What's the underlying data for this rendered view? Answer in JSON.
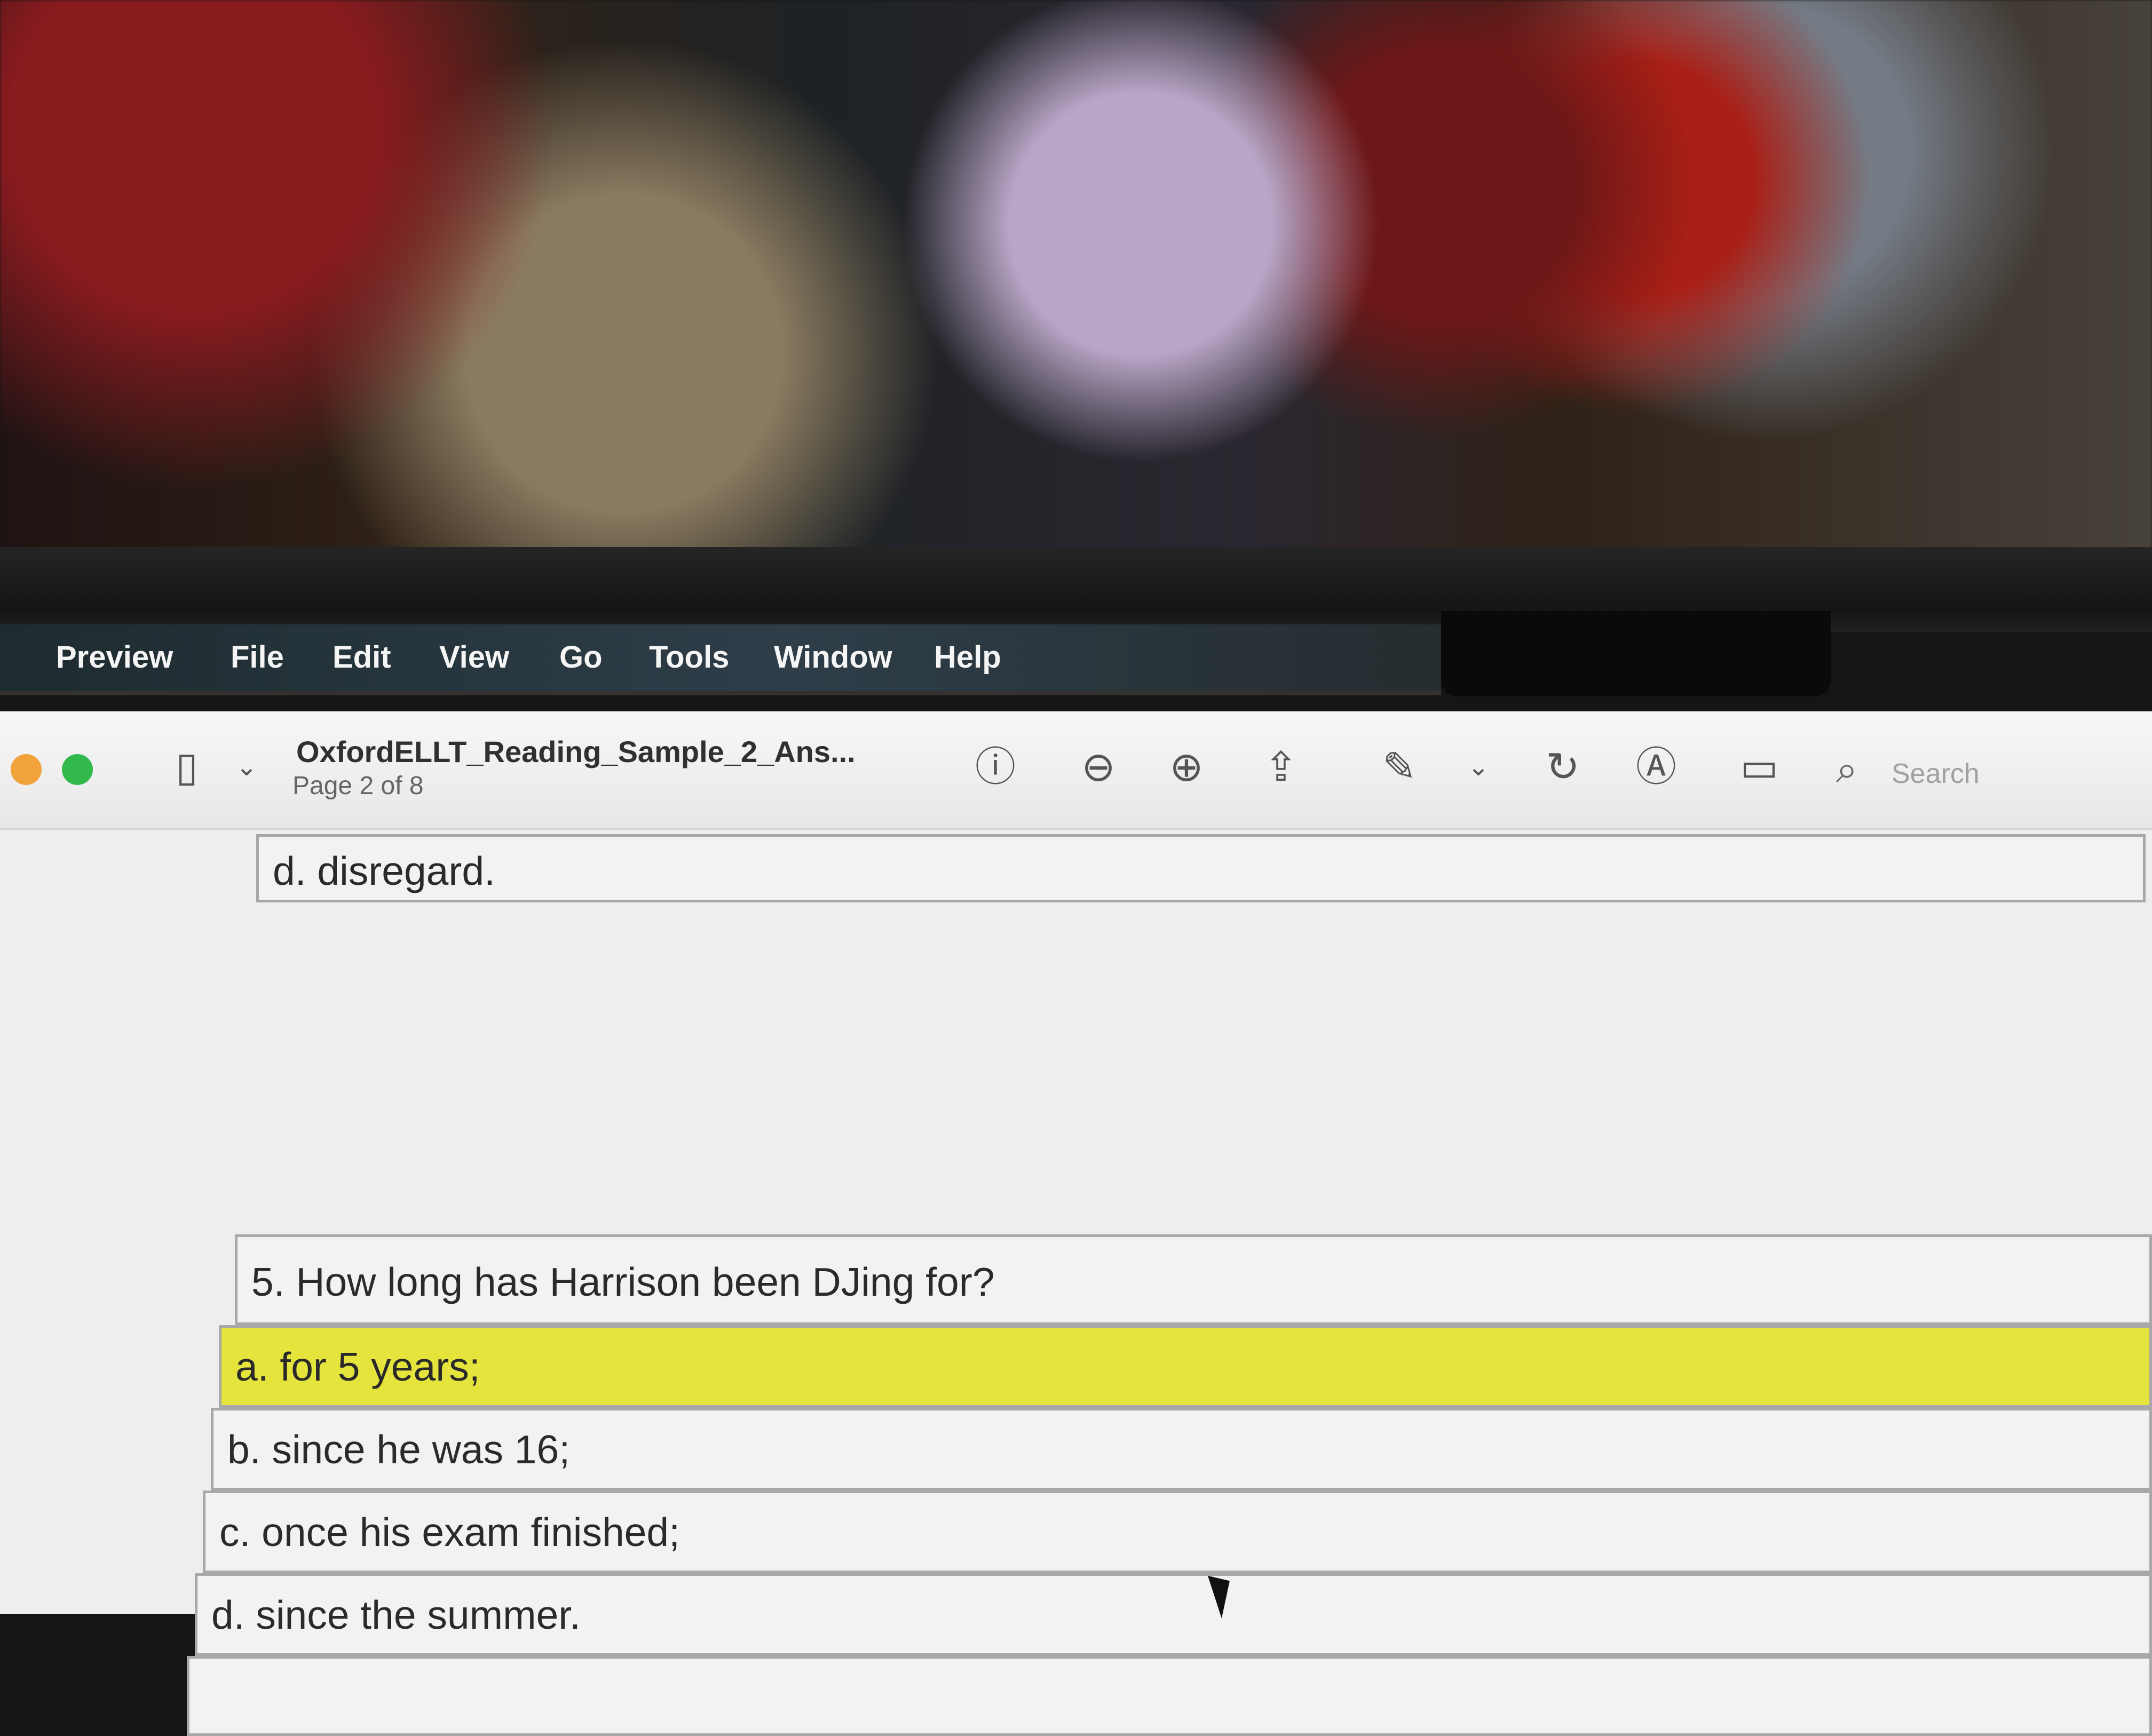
{
  "menu": {
    "items": [
      "Preview",
      "File",
      "Edit",
      "View",
      "Go",
      "Tools",
      "Window",
      "Help"
    ]
  },
  "toolbar": {
    "title": "OxfordELLT_Reading_Sample_2_Ans...",
    "page": "Page 2 of 8",
    "search_placeholder": "Search",
    "icons": {
      "sidebar": "sidebar-icon",
      "sidebar_menu": "chevron-down-icon",
      "info": "info-icon",
      "zoom_out": "zoom-out-icon",
      "zoom_in": "zoom-in-icon",
      "share": "share-icon",
      "markup": "pencil-icon",
      "markup_menu": "chevron-down-icon",
      "rotate": "rotate-icon",
      "annotate": "annotate-icon",
      "form": "form-icon",
      "search": "search-icon"
    }
  },
  "document": {
    "prior_answer": "d. disregard.",
    "question": "5. How long has Harrison been DJing for?",
    "options": [
      "a. for 5 years;",
      "b. since he was 16;",
      "c. once his exam finished;",
      "d. since the summer."
    ],
    "highlight_color": "#e4e43d"
  },
  "colors": {
    "toolbar": "#f3f3f3",
    "page": "#eeeeee",
    "text": "#2a2a2a",
    "close": "#f1a23a",
    "maximize": "#32b94c"
  }
}
